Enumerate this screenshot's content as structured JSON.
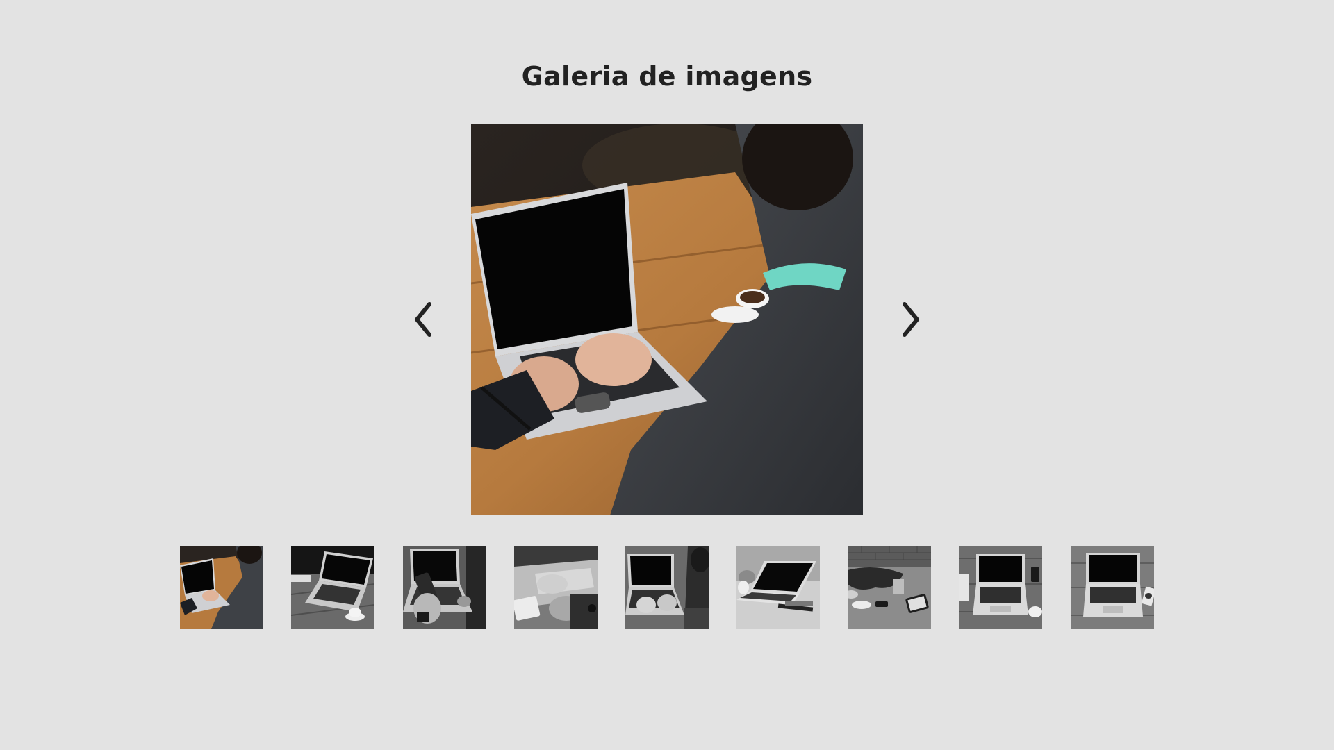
{
  "gallery": {
    "title": "Galeria de imagens",
    "prev_icon": "chevron-left-icon",
    "next_icon": "chevron-right-icon",
    "main_image": "laptop-person-typing-photo",
    "thumbnails": [
      {
        "name": "thumbnail-1",
        "subject": "person typing on laptop at wooden table",
        "color": "color"
      },
      {
        "name": "thumbnail-2",
        "subject": "laptop with coffee cup",
        "color": "grayscale"
      },
      {
        "name": "thumbnail-3",
        "subject": "hand holding phone by laptop",
        "color": "grayscale"
      },
      {
        "name": "thumbnail-4",
        "subject": "hands at laptop keyboard",
        "color": "grayscale"
      },
      {
        "name": "thumbnail-5",
        "subject": "person typing on laptop",
        "color": "grayscale"
      },
      {
        "name": "thumbnail-6",
        "subject": "laptop on table",
        "color": "grayscale"
      },
      {
        "name": "thumbnail-7",
        "subject": "table with jacket, glass and tablet",
        "color": "grayscale"
      },
      {
        "name": "thumbnail-8",
        "subject": "open laptop on wooden desk",
        "color": "grayscale"
      },
      {
        "name": "thumbnail-9",
        "subject": "open laptop on wooden planks",
        "color": "grayscale"
      }
    ]
  },
  "colors": {
    "background": "#e3e3e3",
    "title": "#222222",
    "arrow": "#222222"
  }
}
